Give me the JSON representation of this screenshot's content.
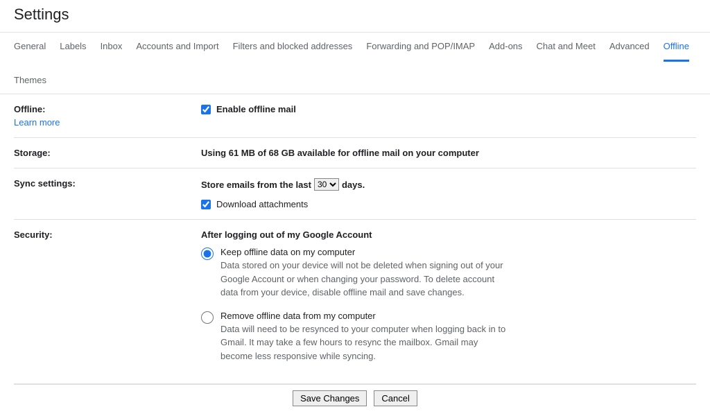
{
  "page_title": "Settings",
  "tabs": {
    "general": "General",
    "labels": "Labels",
    "inbox": "Inbox",
    "accounts": "Accounts and Import",
    "filters": "Filters and blocked addresses",
    "forwarding": "Forwarding and POP/IMAP",
    "addons": "Add-ons",
    "chat": "Chat and Meet",
    "advanced": "Advanced",
    "offline": "Offline",
    "themes": "Themes"
  },
  "offline": {
    "label": "Offline:",
    "learn_more": "Learn more",
    "enable_label": "Enable offline mail"
  },
  "storage": {
    "label": "Storage:",
    "text": "Using 61 MB of 68 GB available for offline mail on your computer"
  },
  "sync": {
    "label": "Sync settings:",
    "prefix": "Store emails from the last",
    "value": "30",
    "suffix": "days.",
    "download_label": "Download attachments"
  },
  "security": {
    "label": "Security:",
    "heading": "After logging out of my Google Account",
    "keep": {
      "title": "Keep offline data on my computer",
      "desc": "Data stored on your device will not be deleted when signing out of your Google Account or when changing your password. To delete account data from your device, disable offline mail and save changes."
    },
    "remove": {
      "title": "Remove offline data from my computer",
      "desc": "Data will need to be resynced to your computer when logging back in to Gmail. It may take a few hours to resync the mailbox. Gmail may become less responsive while syncing."
    }
  },
  "actions": {
    "save": "Save Changes",
    "cancel": "Cancel"
  }
}
